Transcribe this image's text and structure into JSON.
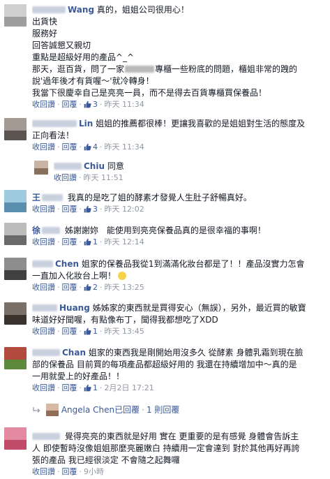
{
  "actions": {
    "reply_left": "收回讚",
    "reply": "回覆",
    "dot": "·"
  },
  "comments": [
    {
      "name": "Wang",
      "lines": [
        "真的，姐姐公司很用心！",
        "出貨快",
        "服務好",
        "回答誠懇又親切",
        "重點是超級好用的產品^_^",
        "那天，逛百貨，問了一家",
        "專櫃一些粉底的問題，櫃姐非常的跩的",
        "說'過年後才有貨喔～'就冷轉身！",
        "我當下很慶幸自己是亮亮一員，而不是得去百貨專櫃買保養品！"
      ],
      "likes": "3",
      "time": "昨天 11:34"
    },
    {
      "name": "Lin",
      "lines": [
        "姐姐的推薦都很棒！更讓我喜歡的是姐姐對生活的態度及",
        "正向看法！"
      ],
      "likes": "4",
      "time": "昨天 11:34"
    },
    {
      "name": "Chiu",
      "lines": [
        "同意"
      ],
      "time": "昨天 11:51"
    },
    {
      "name": "王",
      "lines": [
        "我真的是吃了姐的酵素才發覺人生肚子舒暢真好。"
      ],
      "likes": "3",
      "time": "昨天 12:02"
    },
    {
      "name": "徐",
      "lines": [
        "姊謝謝妳　能使用到亮亮保養品真的是很幸福的事啊！"
      ],
      "likes": "1",
      "time": "昨天 12:14"
    },
    {
      "name": "Chen",
      "lines": [
        "姐家的保養品我從1到滿滿化妝台都是了！！產品沒實力怎會",
        "一直加入化妝台上啊！"
      ],
      "likes": "2",
      "time": "昨天 13:25"
    },
    {
      "name": "Huang",
      "lines": [
        "姊姊家的東西就是買得安心（無誤），另外，最近買的敏寶",
        "味道好好聞喔，有點像布丁，聞得我都想吃了XDD"
      ],
      "likes": "1",
      "time": "昨天 13:45"
    },
    {
      "name": "Chan",
      "lines": [
        "姐家的東西我是剛開始用沒多久 從酵素 身體乳霜到現在臉",
        "部的保養品 目前買的每項產品都超級好用的 我還在持續增加中～真的是",
        "一用就愛上的好產品！！"
      ],
      "likes": "1",
      "time": "2月2日 17:21"
    },
    {
      "lines": [
        "覺得亮亮的東西就是好用 實在 更重要的是有感覺 身體會告訴主",
        "人 即使暫時沒像姐姐那麼亮麗嫩白 持續用一定會達到 對於其他再好再誇",
        "張的產品 我已經很淡定 不會隨之起舞囉"
      ],
      "time": "9小時"
    }
  ],
  "reply_summary": {
    "who": "Angela Chen已回覆",
    "count": "1 則回覆"
  },
  "colors": {
    "link": "#3b5998",
    "meta": "#9197a3",
    "text": "#141823"
  }
}
